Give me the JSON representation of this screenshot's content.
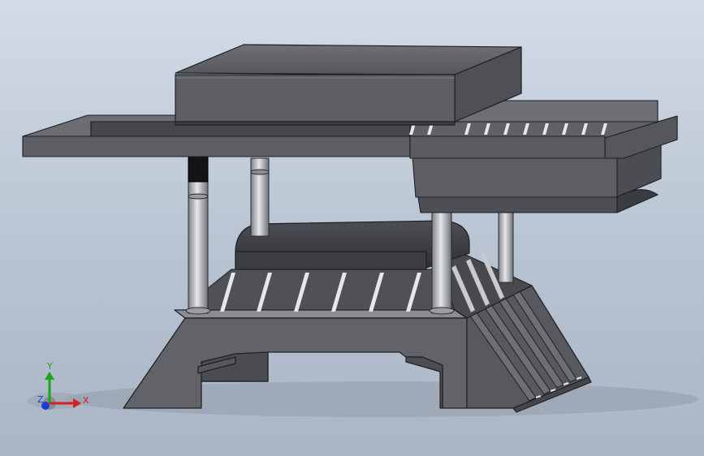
{
  "viewport": {
    "background_top": "#d3dbe6",
    "background_bottom": "#aab6c6"
  },
  "model": {
    "body_color": "#5f6166",
    "dark_color": "#3a3b3f",
    "light_color": "#7c7e84",
    "rod_color": "#b9bcc2",
    "collar_color": "#141414",
    "slot_color": "#e8e8ea"
  },
  "triad": {
    "x_label": "X",
    "y_label": "Y",
    "z_label": "Z",
    "x_color": "#d21f1f",
    "y_color": "#19a619",
    "z_color": "#1f3cd2"
  }
}
